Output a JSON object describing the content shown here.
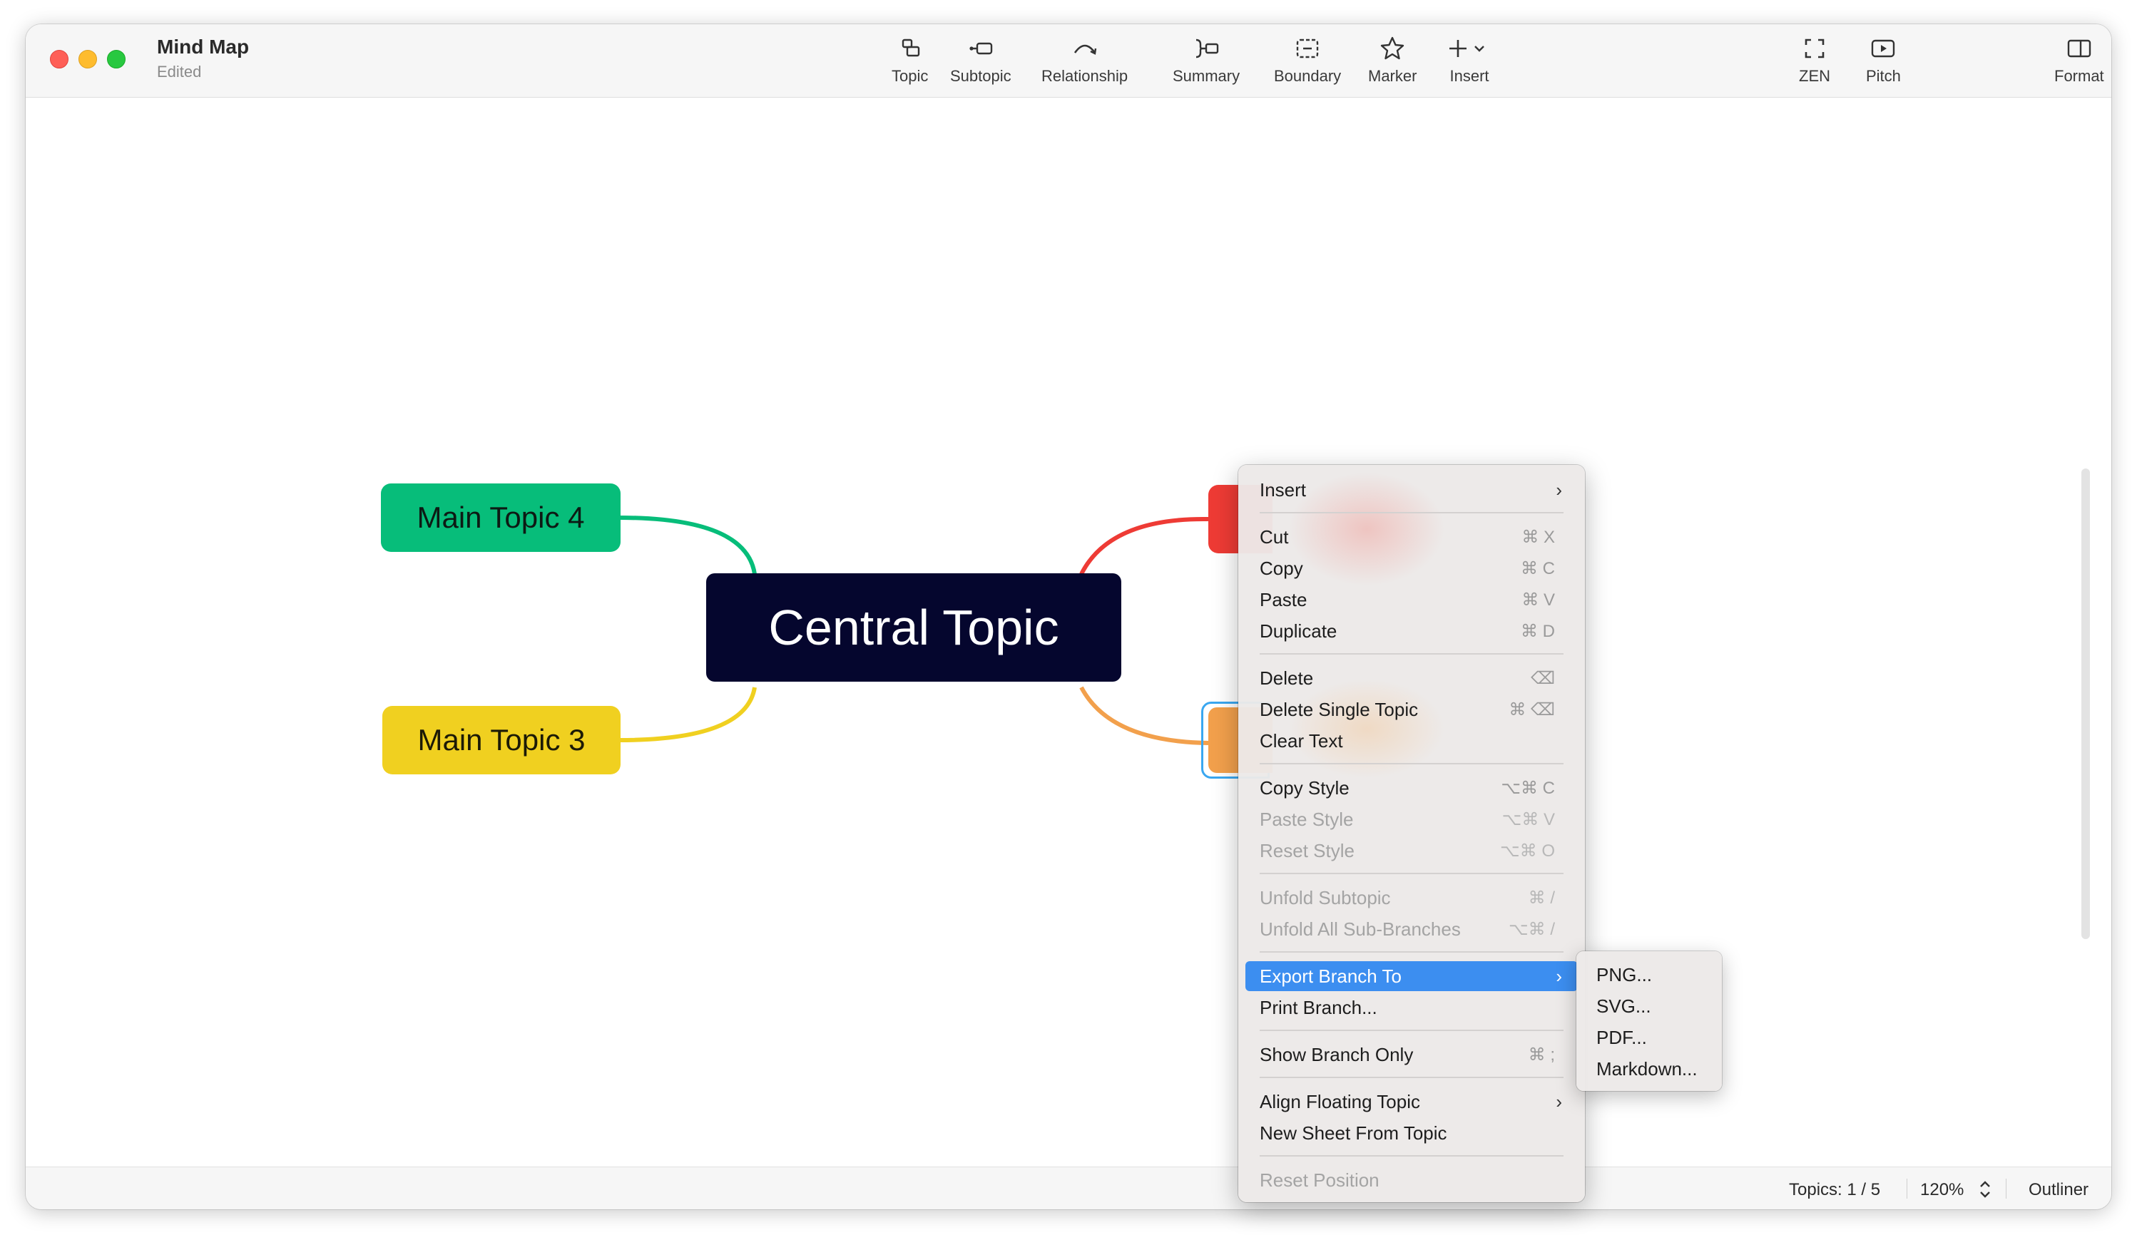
{
  "window": {
    "title": "Mind Map",
    "subtitle": "Edited"
  },
  "toolbar": {
    "topic": "Topic",
    "subtopic": "Subtopic",
    "relationship": "Relationship",
    "summary": "Summary",
    "boundary": "Boundary",
    "marker": "Marker",
    "insert": "Insert",
    "zen": "ZEN",
    "pitch": "Pitch",
    "format": "Format"
  },
  "map": {
    "central": "Central Topic",
    "main_topic_4": "Main Topic 4",
    "main_topic_3": "Main Topic 3",
    "colors": {
      "central": "#05062e",
      "topic4": "#07bd7a",
      "topic3": "#f0d020",
      "topic1": "#ee3b35",
      "topic2": "#f2a04c",
      "selection": "#3aa7f0"
    }
  },
  "context_menu": {
    "insert": "Insert",
    "cut": "Cut",
    "cut_sc": "⌘ X",
    "copy": "Copy",
    "copy_sc": "⌘ C",
    "paste": "Paste",
    "paste_sc": "⌘ V",
    "duplicate": "Duplicate",
    "duplicate_sc": "⌘ D",
    "delete": "Delete",
    "delete_sc": "⌫",
    "delete_single": "Delete Single Topic",
    "delete_single_sc": "⌘ ⌫",
    "clear_text": "Clear Text",
    "copy_style": "Copy Style",
    "copy_style_sc": "⌥⌘ C",
    "paste_style": "Paste Style",
    "paste_style_sc": "⌥⌘ V",
    "reset_style": "Reset Style",
    "reset_style_sc": "⌥⌘ O",
    "unfold_subtopic": "Unfold Subtopic",
    "unfold_subtopic_sc": "⌘ /",
    "unfold_all": "Unfold All Sub-Branches",
    "unfold_all_sc": "⌥⌘ /",
    "export_branch": "Export Branch To",
    "print_branch": "Print Branch...",
    "show_branch_only": "Show Branch Only",
    "show_branch_only_sc": "⌘ ;",
    "align_floating": "Align Floating Topic",
    "new_sheet": "New Sheet From Topic",
    "reset_position": "Reset Position",
    "highlight_color": "#3c8ef0"
  },
  "export_submenu": {
    "png": "PNG...",
    "svg": "SVG...",
    "pdf": "PDF...",
    "markdown": "Markdown..."
  },
  "status": {
    "topics": "Topics: 1 / 5",
    "zoom": "120%",
    "outliner": "Outliner"
  }
}
